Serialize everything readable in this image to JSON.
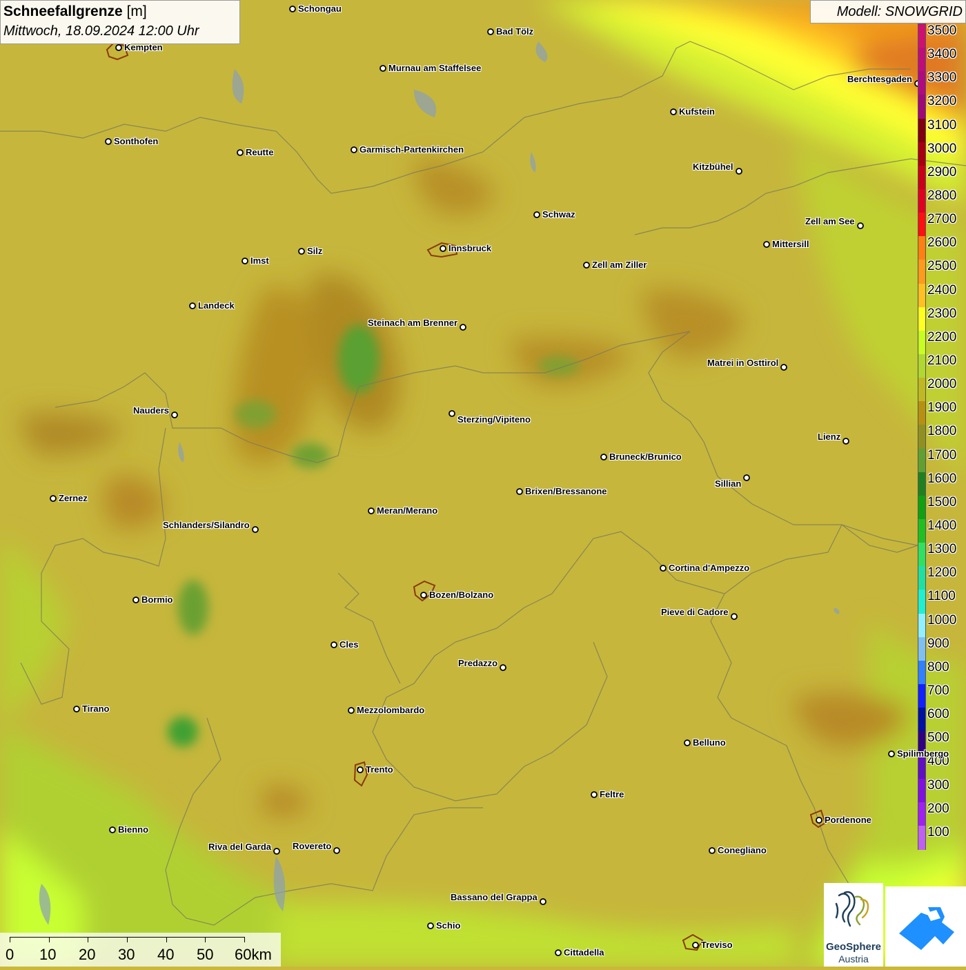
{
  "title": {
    "variable": "Schneefallgrenze",
    "unit": "[m]",
    "datetime": "Mittwoch, 18.09.2024 12:00 Uhr"
  },
  "model": "Modell: SNOWGRID",
  "legend": [
    {
      "label": "3500",
      "color": "#d01070"
    },
    {
      "label": "3400",
      "color": "#c00c78"
    },
    {
      "label": "3300",
      "color": "#b00a80"
    },
    {
      "label": "3200",
      "color": "#a00878"
    },
    {
      "label": "3100",
      "color": "#800010"
    },
    {
      "label": "3000",
      "color": "#a80010"
    },
    {
      "label": "2900",
      "color": "#c80018"
    },
    {
      "label": "2800",
      "color": "#e00020"
    },
    {
      "label": "2700",
      "color": "#ff1010"
    },
    {
      "label": "2600",
      "color": "#ff8010"
    },
    {
      "label": "2500",
      "color": "#ff9a1a"
    },
    {
      "label": "2400",
      "color": "#ffc020"
    },
    {
      "label": "2300",
      "color": "#ffff20"
    },
    {
      "label": "2200",
      "color": "#c8ff20"
    },
    {
      "label": "2100",
      "color": "#b0d830"
    },
    {
      "label": "2000",
      "color": "#c0b820"
    },
    {
      "label": "1900",
      "color": "#b89010"
    },
    {
      "label": "1800",
      "color": "#909020"
    },
    {
      "label": "1700",
      "color": "#60a030"
    },
    {
      "label": "1600",
      "color": "#208020"
    },
    {
      "label": "1500",
      "color": "#10a010"
    },
    {
      "label": "1400",
      "color": "#20c020"
    },
    {
      "label": "1300",
      "color": "#30e060"
    },
    {
      "label": "1200",
      "color": "#20e0a0"
    },
    {
      "label": "1100",
      "color": "#20f0d0"
    },
    {
      "label": "1000",
      "color": "#90f0ff"
    },
    {
      "label": "900",
      "color": "#80c0f0"
    },
    {
      "label": "800",
      "color": "#3080ff"
    },
    {
      "label": "700",
      "color": "#1020ff"
    },
    {
      "label": "600",
      "color": "#0010a0"
    },
    {
      "label": "500",
      "color": "#300080"
    },
    {
      "label": "400",
      "color": "#6010c0"
    },
    {
      "label": "300",
      "color": "#8010e0"
    },
    {
      "label": "200",
      "color": "#a020f0"
    },
    {
      "label": "100",
      "color": "#c060f0"
    }
  ],
  "scale": {
    "labels": [
      "0",
      "10",
      "20",
      "30",
      "40",
      "50",
      "60km"
    ]
  },
  "logos": {
    "geosphere_line1": "GeoSphere",
    "geosphere_line2": "Austria"
  },
  "cities": [
    {
      "name": "Schongau"
    },
    {
      "name": "Kempten"
    },
    {
      "name": "Bad Tölz"
    },
    {
      "name": "Murnau am Staffelsee"
    },
    {
      "name": "Berchtesgaden"
    },
    {
      "name": "Kufstein"
    },
    {
      "name": "Sonthofen"
    },
    {
      "name": "Reutte"
    },
    {
      "name": "Garmisch-Partenkirchen"
    },
    {
      "name": "Kitzbühel"
    },
    {
      "name": "Schwaz"
    },
    {
      "name": "Zell am See"
    },
    {
      "name": "Innsbruck"
    },
    {
      "name": "Mittersill"
    },
    {
      "name": "Imst"
    },
    {
      "name": "Silz"
    },
    {
      "name": "Zell am Ziller"
    },
    {
      "name": "Landeck"
    },
    {
      "name": "Steinach am Brenner"
    },
    {
      "name": "Matrei in Osttirol"
    },
    {
      "name": "Nauders"
    },
    {
      "name": "Sterzing/Vipiteno"
    },
    {
      "name": "Lienz"
    },
    {
      "name": "Bruneck/Brunico"
    },
    {
      "name": "Sillian"
    },
    {
      "name": "Brixen/Bressanone"
    },
    {
      "name": "Zernez"
    },
    {
      "name": "Meran/Merano"
    },
    {
      "name": "Schlanders/Silandro"
    },
    {
      "name": "Cortina d'Ampezzo"
    },
    {
      "name": "Bozen/Bolzano"
    },
    {
      "name": "Bormio"
    },
    {
      "name": "Pieve di Cadore"
    },
    {
      "name": "Cles"
    },
    {
      "name": "Predazzo"
    },
    {
      "name": "Tirano"
    },
    {
      "name": "Mezzolombardo"
    },
    {
      "name": "Belluno"
    },
    {
      "name": "Spilimbergo"
    },
    {
      "name": "Trento"
    },
    {
      "name": "Feltre"
    },
    {
      "name": "Pordenone"
    },
    {
      "name": "Bienno"
    },
    {
      "name": "Riva del Garda"
    },
    {
      "name": "Rovereto"
    },
    {
      "name": "Conegliano"
    },
    {
      "name": "Bassano del Grappa"
    },
    {
      "name": "Schio"
    },
    {
      "name": "Treviso"
    },
    {
      "name": "Cittadella"
    }
  ]
}
